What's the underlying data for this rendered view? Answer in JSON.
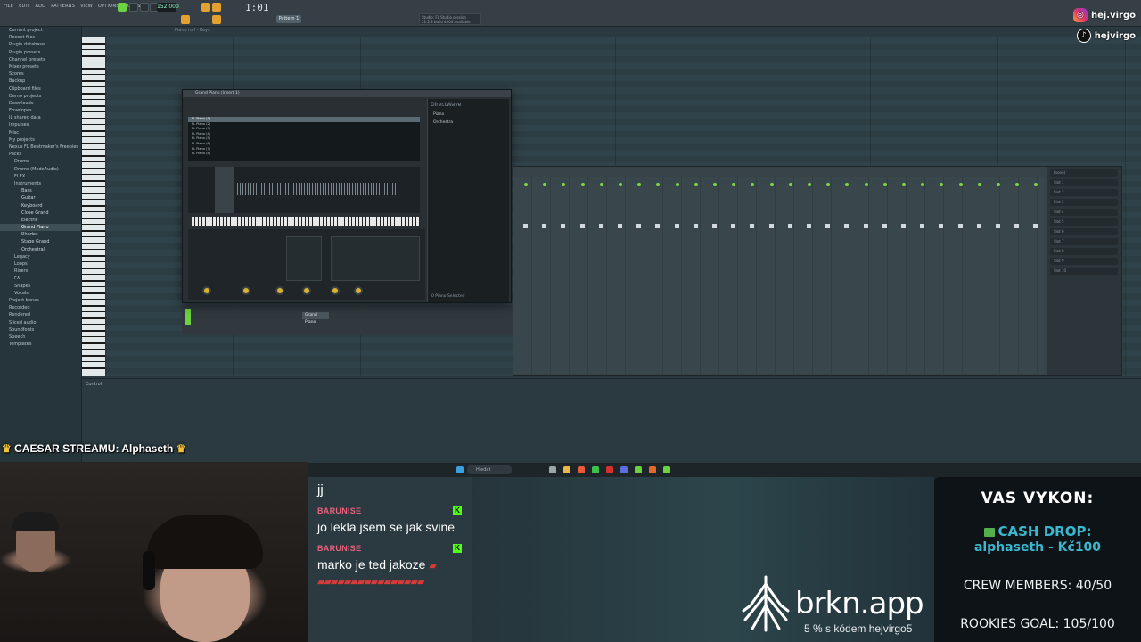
{
  "daw": {
    "menu": [
      "FILE",
      "EDIT",
      "ADD",
      "PATTERNS",
      "VIEW",
      "OPTIONS",
      "TOOLS",
      "HELP"
    ],
    "tempo": "152.000",
    "time": "1:01",
    "pattern": "Pattern 1",
    "hint": "Piano roll - Keys",
    "news": [
      "Studio: FL Studio session",
      "21.2.3 build 4004 available"
    ],
    "browser_items": [
      "Current project",
      "Recent files",
      "Plugin database",
      "Plugin presets",
      "Channel presets",
      "Mixer presets",
      "Scores",
      "Backup",
      "Clipboard files",
      "Demo projects",
      "Downloads",
      "Envelopes",
      "IL shared data",
      "Impulses",
      "Misc",
      "My projects",
      "Nexus FL Beatmaker's Freebies",
      "Packs",
      "Drums",
      "Drums (ModeAudio)",
      "FLEX",
      "Instruments",
      "Bass",
      "Guitar",
      "Keyboard",
      "Close Grand",
      "Electric",
      "Grand Piano",
      "Rhodes",
      "Stage Grand",
      "Orchestral",
      "Legacy",
      "Loops",
      "Risers",
      "FX",
      "Shapes",
      "Vocals",
      "Project bones",
      "Recorded",
      "Rendered",
      "Sliced audio",
      "Soundfonts",
      "Speech",
      "Templates"
    ],
    "control_label": "Control",
    "plugin": {
      "title": "Grand Piano (Insert 1)",
      "presets": [
        "FL Piano (1)",
        "FL Piano (2)",
        "FL Piano (3)",
        "FL Piano (4)",
        "FL Piano (5)",
        "FL Piano (6)",
        "FL Piano (7)",
        "FL Piano (8)"
      ],
      "side_title": "DirectWave",
      "side_items": [
        "Piano",
        "Orchestra"
      ],
      "footer": "0 Piano Selected"
    },
    "channel": "Grand Piano",
    "mixer_slots": [
      "(none)",
      "Slot 1",
      "Slot 2",
      "Slot 3",
      "Slot 4",
      "Slot 5",
      "Slot 6",
      "Slot 7",
      "Slot 8",
      "Slot 9",
      "Slot 10"
    ],
    "taskbar_search": "Hledat"
  },
  "social": {
    "instagram": "hej.virgo",
    "tiktok": "hejvirgo"
  },
  "overlay": {
    "caesar_label": "CAESAR STREAMU: Alphaseth",
    "chat": [
      {
        "user": "",
        "text": "jj",
        "kick": false
      },
      {
        "user": "BARUNISE",
        "text": "jo lekla jsem se jak svine",
        "kick": true
      },
      {
        "user": "BARUNISE",
        "text": "marko je ted jakoze",
        "kick": true
      }
    ],
    "brkn": {
      "brand": "brkn.app",
      "promo": "5 % s kódem hejvirgo5"
    },
    "stats": {
      "title": "VAS VYKON:",
      "cash_drop": "CASH DROP:",
      "cash_drop_name": "alphaseth - Kč100",
      "crew": "CREW MEMBERS: 40/50",
      "rookies": "ROOKIES GOAL: 105/100"
    }
  },
  "colors": {
    "accent_orange": "#e2a130",
    "accent_green": "#6bd241",
    "chat_user": "#e8637d",
    "kick_green": "#53fc18",
    "cash_blue": "#3bb8d0"
  }
}
